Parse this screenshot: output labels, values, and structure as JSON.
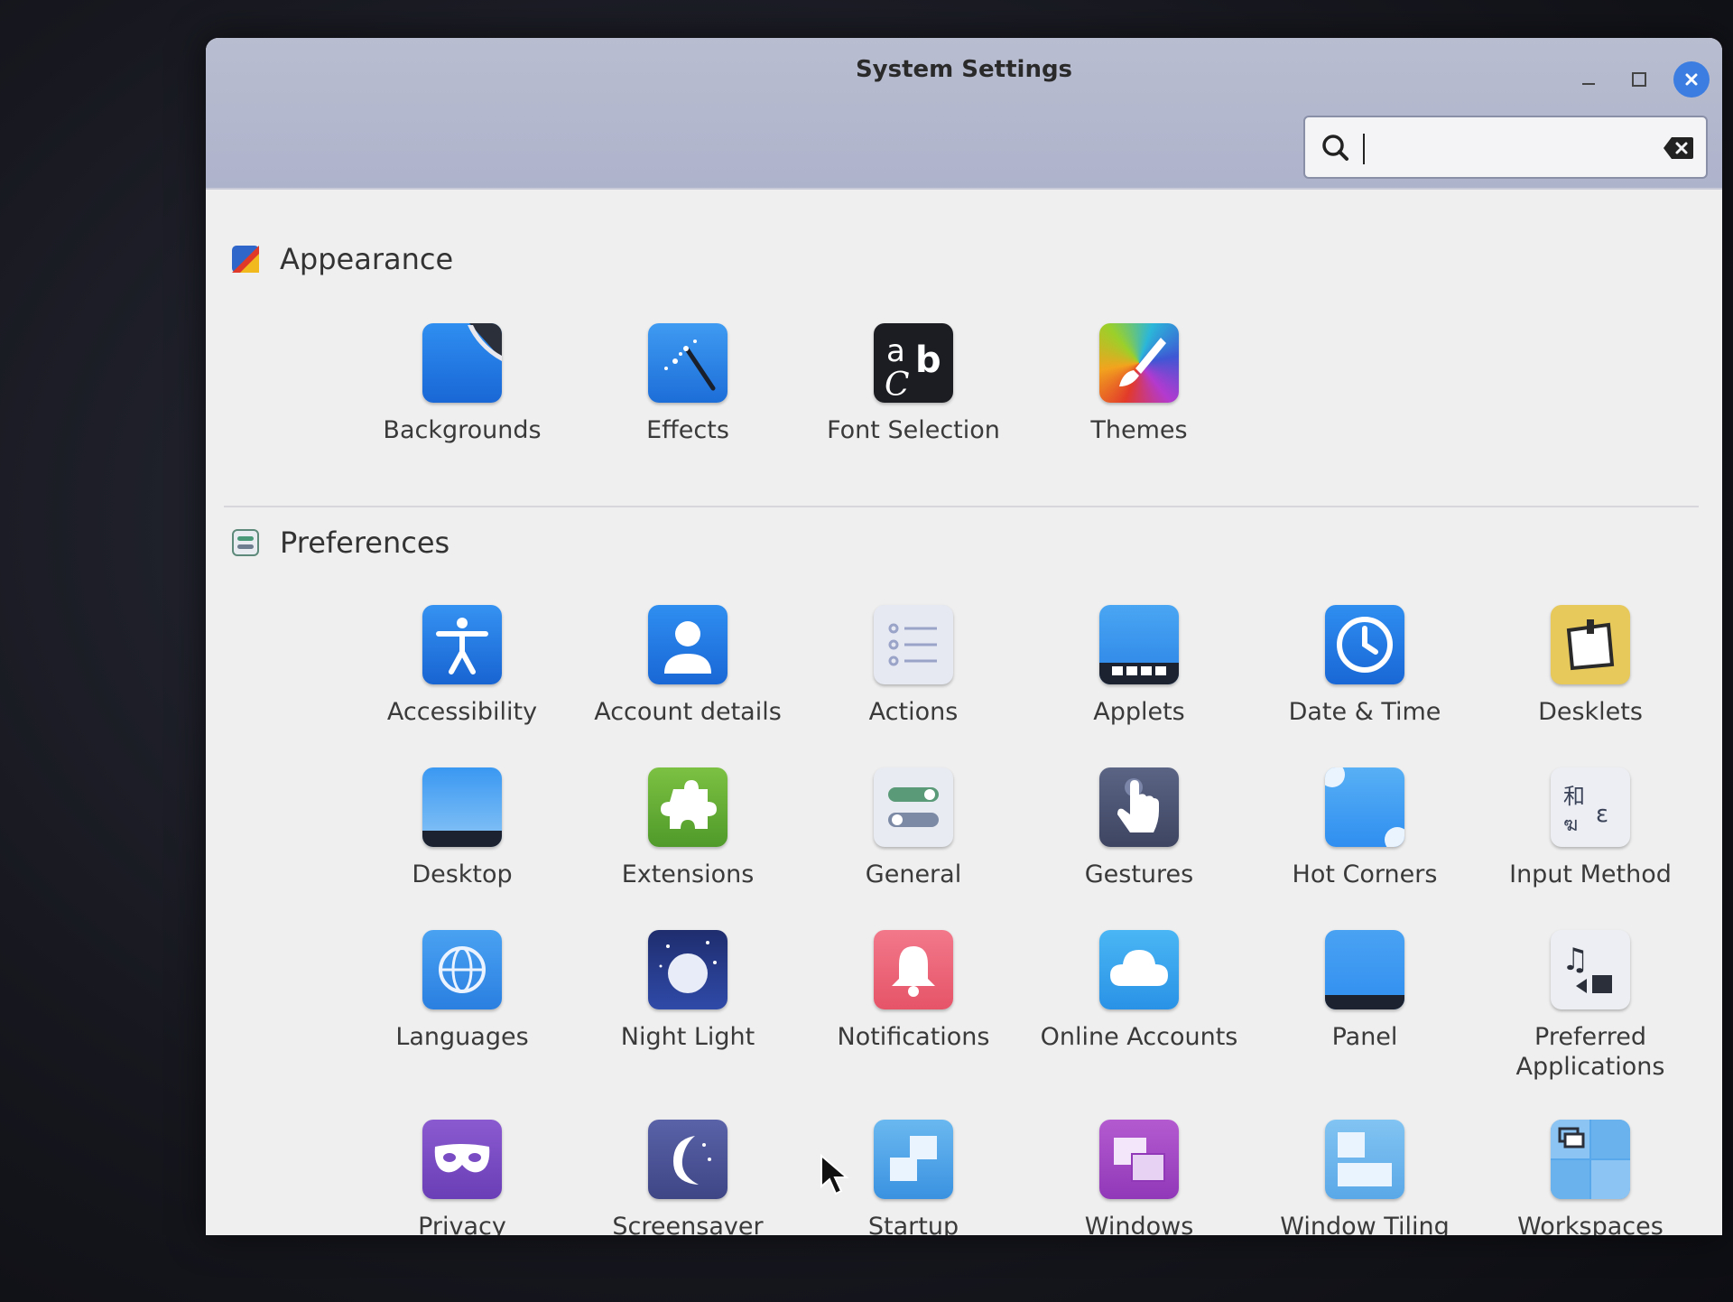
{
  "window": {
    "title": "System Settings"
  },
  "search": {
    "value": "",
    "placeholder": ""
  },
  "sections": [
    {
      "title": "Appearance",
      "items": [
        {
          "label": "Backgrounds"
        },
        {
          "label": "Effects"
        },
        {
          "label": "Font Selection"
        },
        {
          "label": "Themes"
        }
      ]
    },
    {
      "title": "Preferences",
      "items": [
        {
          "label": "Accessibility"
        },
        {
          "label": "Account details"
        },
        {
          "label": "Actions"
        },
        {
          "label": "Applets"
        },
        {
          "label": "Date & Time"
        },
        {
          "label": "Desklets"
        },
        {
          "label": "Desktop"
        },
        {
          "label": "Extensions"
        },
        {
          "label": "General"
        },
        {
          "label": "Gestures"
        },
        {
          "label": "Hot Corners"
        },
        {
          "label": "Input Method"
        },
        {
          "label": "Languages"
        },
        {
          "label": "Night Light"
        },
        {
          "label": "Notifications"
        },
        {
          "label": "Online Accounts"
        },
        {
          "label": "Panel"
        },
        {
          "label": "Preferred Applications"
        },
        {
          "label": "Privacy"
        },
        {
          "label": "Screensaver"
        },
        {
          "label": "Startup Applications"
        },
        {
          "label": "Windows"
        },
        {
          "label": "Window Tiling"
        },
        {
          "label": "Workspaces"
        }
      ]
    }
  ],
  "colors": {
    "accent": "#3b7de0",
    "titlebar": "#b1b6cd"
  }
}
